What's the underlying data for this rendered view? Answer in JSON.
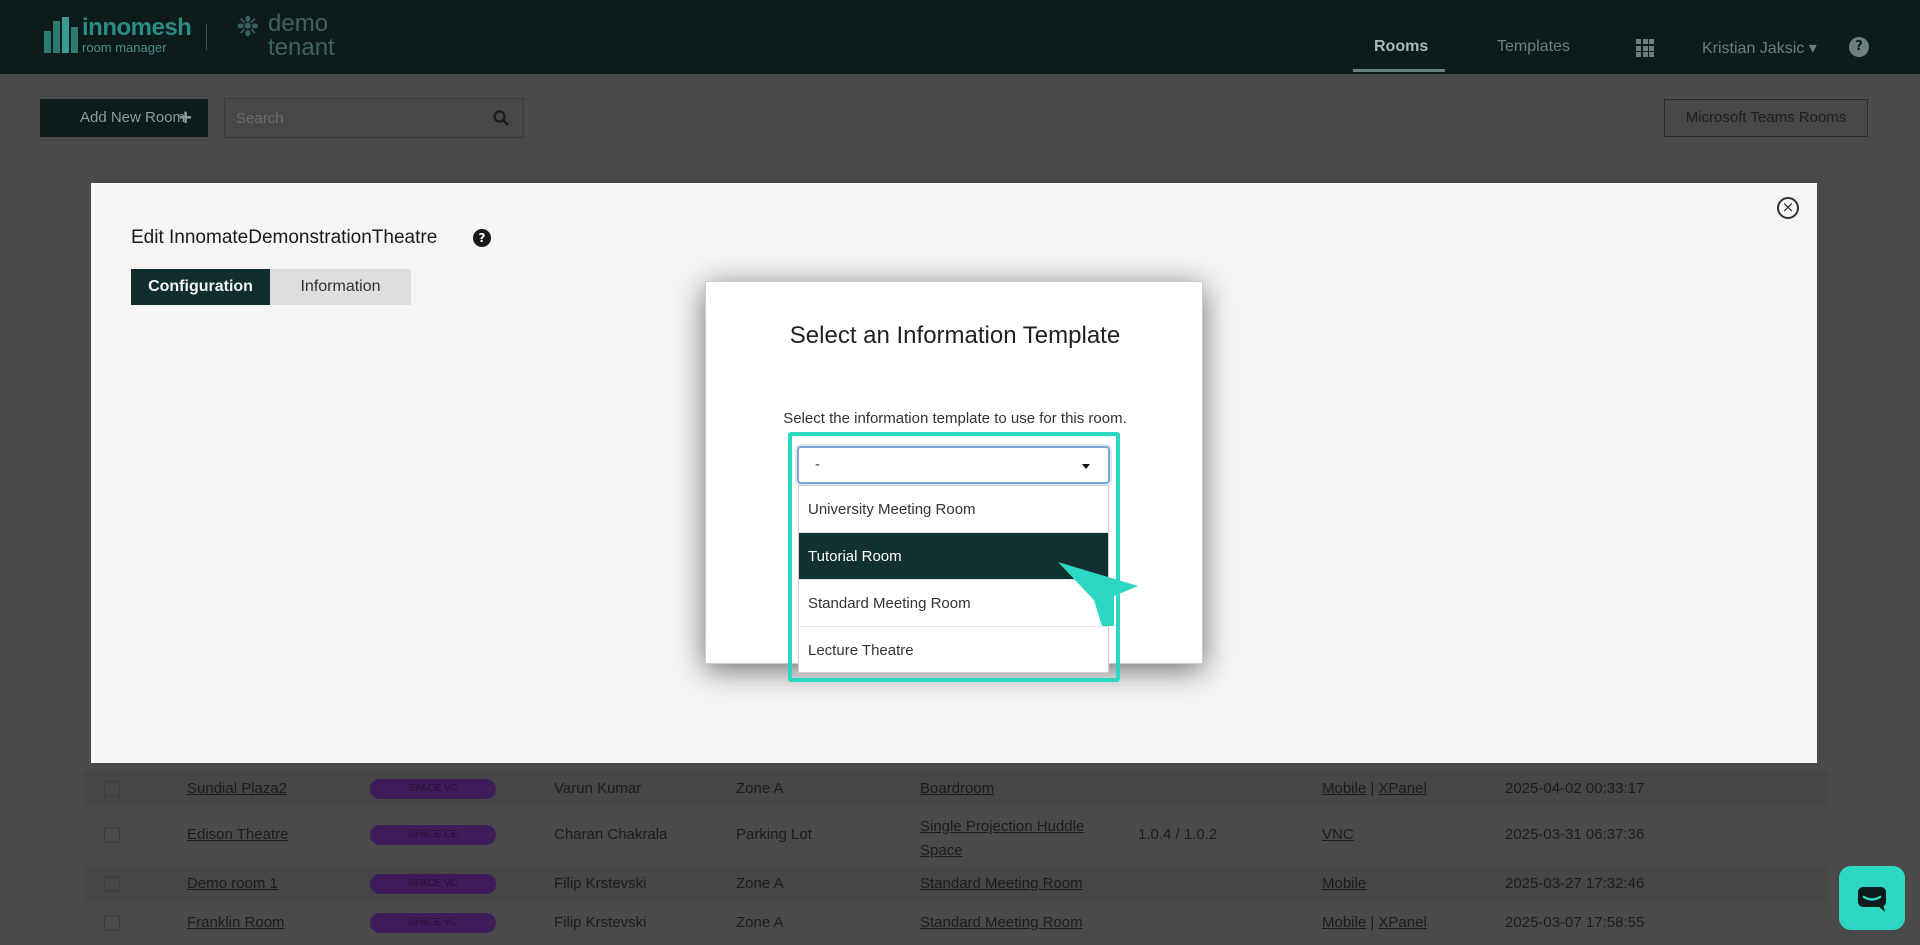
{
  "app": {
    "brand": "innomesh",
    "brand_sub": "room manager",
    "tenant": "demo tenant"
  },
  "nav": {
    "rooms": "Rooms",
    "templates": "Templates",
    "user": "Kristian Jaksic ▾",
    "help": "?"
  },
  "toolbar": {
    "add_room": "Add New Room",
    "add_icon": "+",
    "search_placeholder": "Search",
    "teams_rooms": "Microsoft Teams Rooms"
  },
  "modal": {
    "title": "Edit InnomateDemonstrationTheatre",
    "help": "?",
    "close": "×",
    "tabs": [
      "Configuration",
      "Information"
    ]
  },
  "dialog": {
    "title": "Select an Information Template",
    "description": "Select the information template to use for this room.",
    "select_value": "-",
    "options": [
      "University Meeting Room",
      "Tutorial Room",
      "Standard Meeting Room",
      "Lecture Theatre"
    ],
    "selected_index": 1
  },
  "rooms_table": [
    {
      "name": "Sundial Plaza2",
      "badge": "SPACE VC",
      "owner": "Varun Kumar",
      "zone": "Zone A",
      "template": "Boardroom",
      "version": "",
      "control": [
        "Mobile",
        "XPanel"
      ],
      "updated": "2025-04-02 00:33:17"
    },
    {
      "name": "Edison Theatre",
      "badge": "SPACE CE",
      "owner": "Charan Chakrala",
      "zone": "Parking Lot",
      "template": "Single Projection Huddle Space",
      "version": "1.0.4 / 1.0.2",
      "control": [
        "VNC"
      ],
      "updated": "2025-03-31 06:37:36"
    },
    {
      "name": "Demo room 1",
      "badge": "SPACE VC",
      "owner": "Filip Krstevski",
      "zone": "Zone A",
      "template": "Standard Meeting Room",
      "version": "",
      "control": [
        "Mobile"
      ],
      "updated": "2025-03-27 17:32:46"
    },
    {
      "name": "Franklin Room",
      "badge": "SPACE VC",
      "owner": "Filip Krstevski",
      "zone": "Zone A",
      "template": "Standard Meeting Room",
      "version": "",
      "control": [
        "Mobile",
        "XPanel"
      ],
      "updated": "2025-03-07 17:58:55"
    }
  ],
  "colors": {
    "accent": "#2ed6c4",
    "nav_bg": "#0d1b1b",
    "primary": "#113030"
  }
}
